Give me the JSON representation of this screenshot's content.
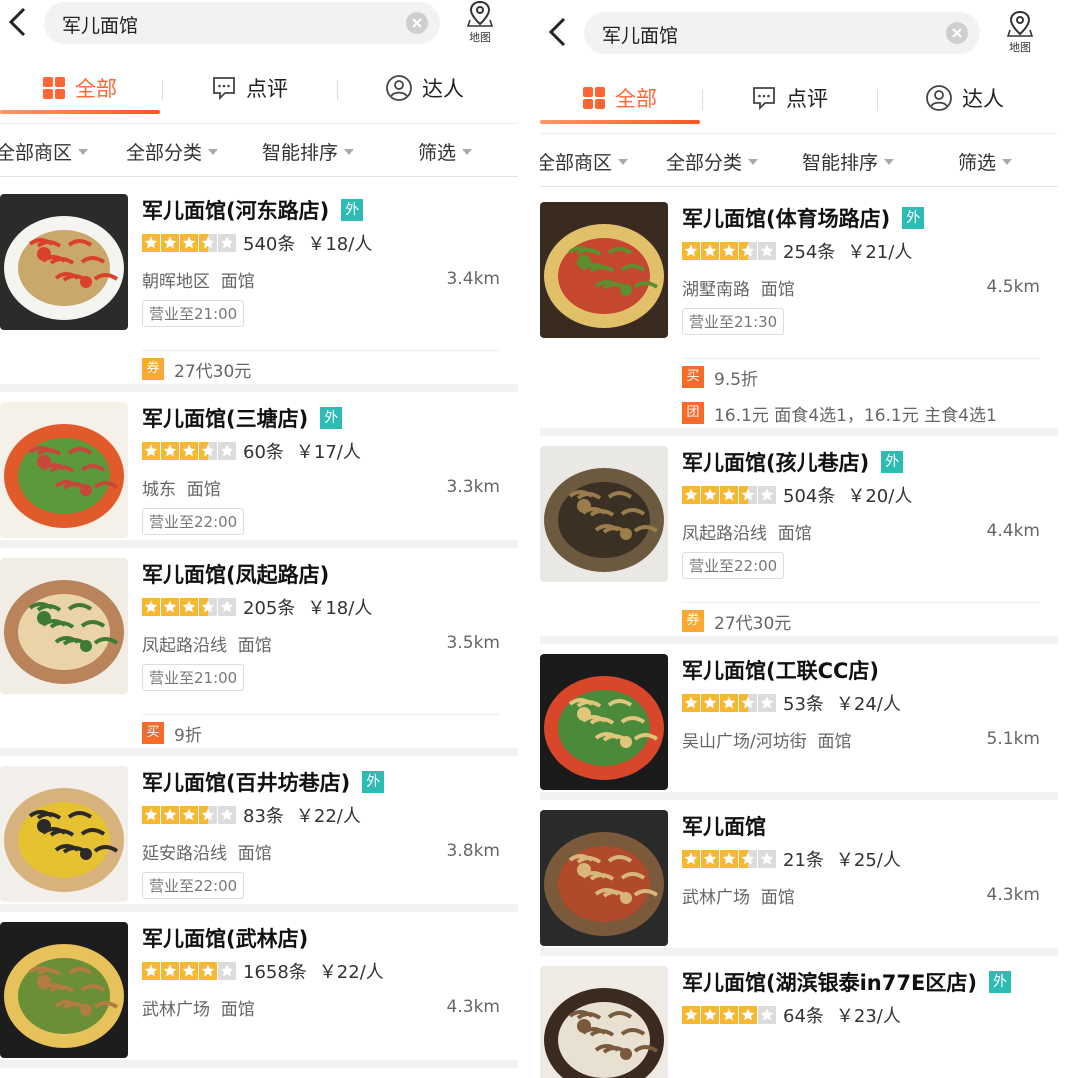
{
  "search": {
    "query": "军儿面馆",
    "map_label": "地图"
  },
  "tabs": {
    "all": "全部",
    "reviews": "点评",
    "experts": "达人"
  },
  "filters": {
    "district": "全部商区",
    "category": "全部分类",
    "sort": "智能排序",
    "filter": "筛选"
  },
  "colors": {
    "accent": "#ff6633",
    "takeout_badge": "#2dbcb4",
    "coupon_tag": "#f9a835",
    "deal_tag": "#f46b2a",
    "star": "#f7b731"
  },
  "left_list": [
    {
      "name": "军儿面馆(河东路店)",
      "takeout": "外",
      "stars": 3.5,
      "reviews": "540条",
      "price": "￥18/人",
      "area": "朝晖地区  面馆",
      "distance": "3.4km",
      "hours": "营业至21:00",
      "promos": [
        {
          "tag": "券",
          "text": "27代30元"
        }
      ]
    },
    {
      "name": "军儿面馆(三塘店)",
      "takeout": "外",
      "stars": 3.5,
      "reviews": "60条",
      "price": "￥17/人",
      "area": "城东  面馆",
      "distance": "3.3km",
      "hours": "营业至22:00",
      "promos": []
    },
    {
      "name": "军儿面馆(凤起路店)",
      "takeout": "",
      "stars": 3.5,
      "reviews": "205条",
      "price": "￥18/人",
      "area": "凤起路沿线  面馆",
      "distance": "3.5km",
      "hours": "营业至21:00",
      "promos": [
        {
          "tag": "买",
          "text": "9折"
        }
      ]
    },
    {
      "name": "军儿面馆(百井坊巷店)",
      "takeout": "外",
      "stars": 3.5,
      "reviews": "83条",
      "price": "￥22/人",
      "area": "延安路沿线  面馆",
      "distance": "3.8km",
      "hours": "营业至22:00",
      "promos": []
    },
    {
      "name": "军儿面馆(武林店)",
      "takeout": "",
      "stars": 4,
      "reviews": "1658条",
      "price": "￥22/人",
      "area": "武林广场  面馆",
      "distance": "4.3km",
      "hours": "",
      "promos": []
    }
  ],
  "right_list": [
    {
      "name": "军儿面馆(体育场路店)",
      "takeout": "外",
      "stars": 3.5,
      "reviews": "254条",
      "price": "￥21/人",
      "area": "湖墅南路  面馆",
      "distance": "4.5km",
      "hours": "营业至21:30",
      "promos": [
        {
          "tag": "买",
          "text": "9.5折"
        },
        {
          "tag": "团",
          "text": "16.1元 面食4选1，16.1元 主食4选1"
        }
      ]
    },
    {
      "name": "军儿面馆(孩儿巷店)",
      "takeout": "外",
      "stars": 3.5,
      "reviews": "504条",
      "price": "￥20/人",
      "area": "凤起路沿线  面馆",
      "distance": "4.4km",
      "hours": "营业至22:00",
      "promos": [
        {
          "tag": "券",
          "text": "27代30元"
        }
      ]
    },
    {
      "name": "军儿面馆(工联CC店)",
      "takeout": "",
      "stars": 3.5,
      "reviews": "53条",
      "price": "￥24/人",
      "area": "吴山广场/河坊街  面馆",
      "distance": "5.1km",
      "hours": "",
      "promos": []
    },
    {
      "name": "军儿面馆",
      "takeout": "",
      "stars": 3.5,
      "reviews": "21条",
      "price": "￥25/人",
      "area": "武林广场  面馆",
      "distance": "4.3km",
      "hours": "",
      "promos": []
    },
    {
      "name": "军儿面馆(湖滨银泰in77E区店)",
      "takeout": "外",
      "stars": 4,
      "reviews": "64条",
      "price": "￥23/人",
      "area": "",
      "distance": "",
      "hours": "",
      "promos": []
    }
  ]
}
